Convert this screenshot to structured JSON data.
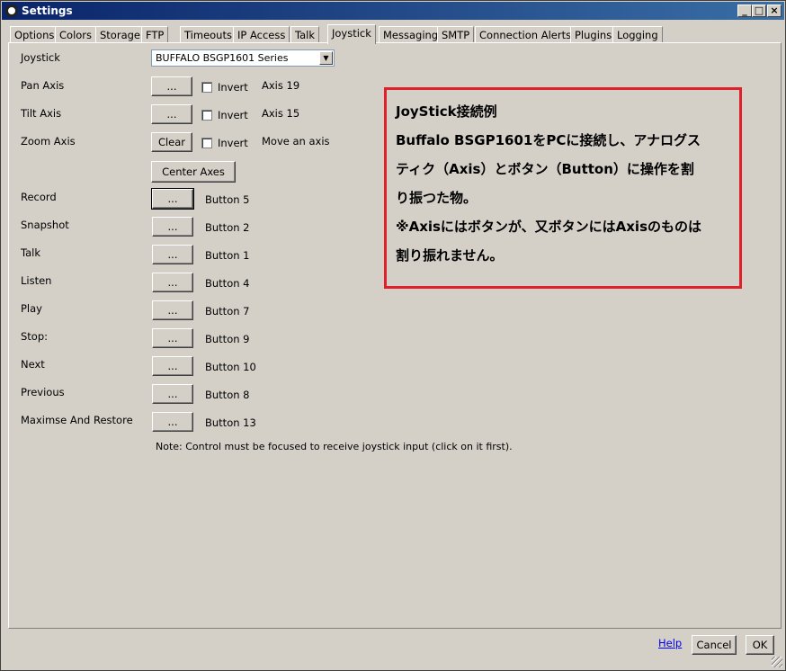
{
  "window": {
    "title": "Settings",
    "controls": {
      "minimize": "_",
      "maximize": "□",
      "close": "×"
    }
  },
  "tabs": [
    {
      "label": "Options"
    },
    {
      "label": "Colors"
    },
    {
      "label": "Storage"
    },
    {
      "label": "FTP"
    },
    {
      "label": "Timeouts"
    },
    {
      "label": "IP Access"
    },
    {
      "label": "Talk"
    },
    {
      "label": "Joystick",
      "active": true
    },
    {
      "label": "Messaging"
    },
    {
      "label": "SMTP"
    },
    {
      "label": "Connection Alerts"
    },
    {
      "label": "Plugins"
    },
    {
      "label": "Logging"
    }
  ],
  "joystick": {
    "label": "Joystick",
    "selected": "BUFFALO BSGP1601 Series",
    "arrow": "▼",
    "axes": [
      {
        "label": "Pan Axis",
        "button": "...",
        "invert": "Invert",
        "value": "Axis 19"
      },
      {
        "label": "Tilt Axis",
        "button": "...",
        "invert": "Invert",
        "value": "Axis 15"
      },
      {
        "label": "Zoom Axis",
        "button": "Clear",
        "invert": "Invert",
        "value": "Move an axis"
      }
    ],
    "center_axes": "Center Axes",
    "buttons": [
      {
        "label": "Record",
        "button": "...",
        "value": "Button 5"
      },
      {
        "label": "Snapshot",
        "button": "...",
        "value": "Button 2"
      },
      {
        "label": "Talk",
        "button": "...",
        "value": "Button 1"
      },
      {
        "label": "Listen",
        "button": "...",
        "value": "Button 4"
      },
      {
        "label": "Play",
        "button": "...",
        "value": "Button 7"
      },
      {
        "label": "Stop:",
        "button": "...",
        "value": "Button 9"
      },
      {
        "label": "Next",
        "button": "...",
        "value": "Button 10"
      },
      {
        "label": "Previous",
        "button": "...",
        "value": "Button 8"
      },
      {
        "label": "Maximse And Restore",
        "button": "...",
        "value": "Button 13"
      }
    ],
    "note": "Note: Control must be focused to receive joystick input (click on it first)."
  },
  "annotation": {
    "border_color": "#e0202a",
    "lines": [
      "JoyStick接続例",
      "Buffalo BSGP1601をPCに接続し、アナログス",
      "ティク（Axis）とボタン（Button）に操作を割",
      "り振つた物。",
      "※Axisにはボタンが、又ボタンにはAxisのものは",
      "割り振れません。"
    ]
  },
  "footer": {
    "help": "Help",
    "cancel": "Cancel",
    "ok": "OK"
  }
}
